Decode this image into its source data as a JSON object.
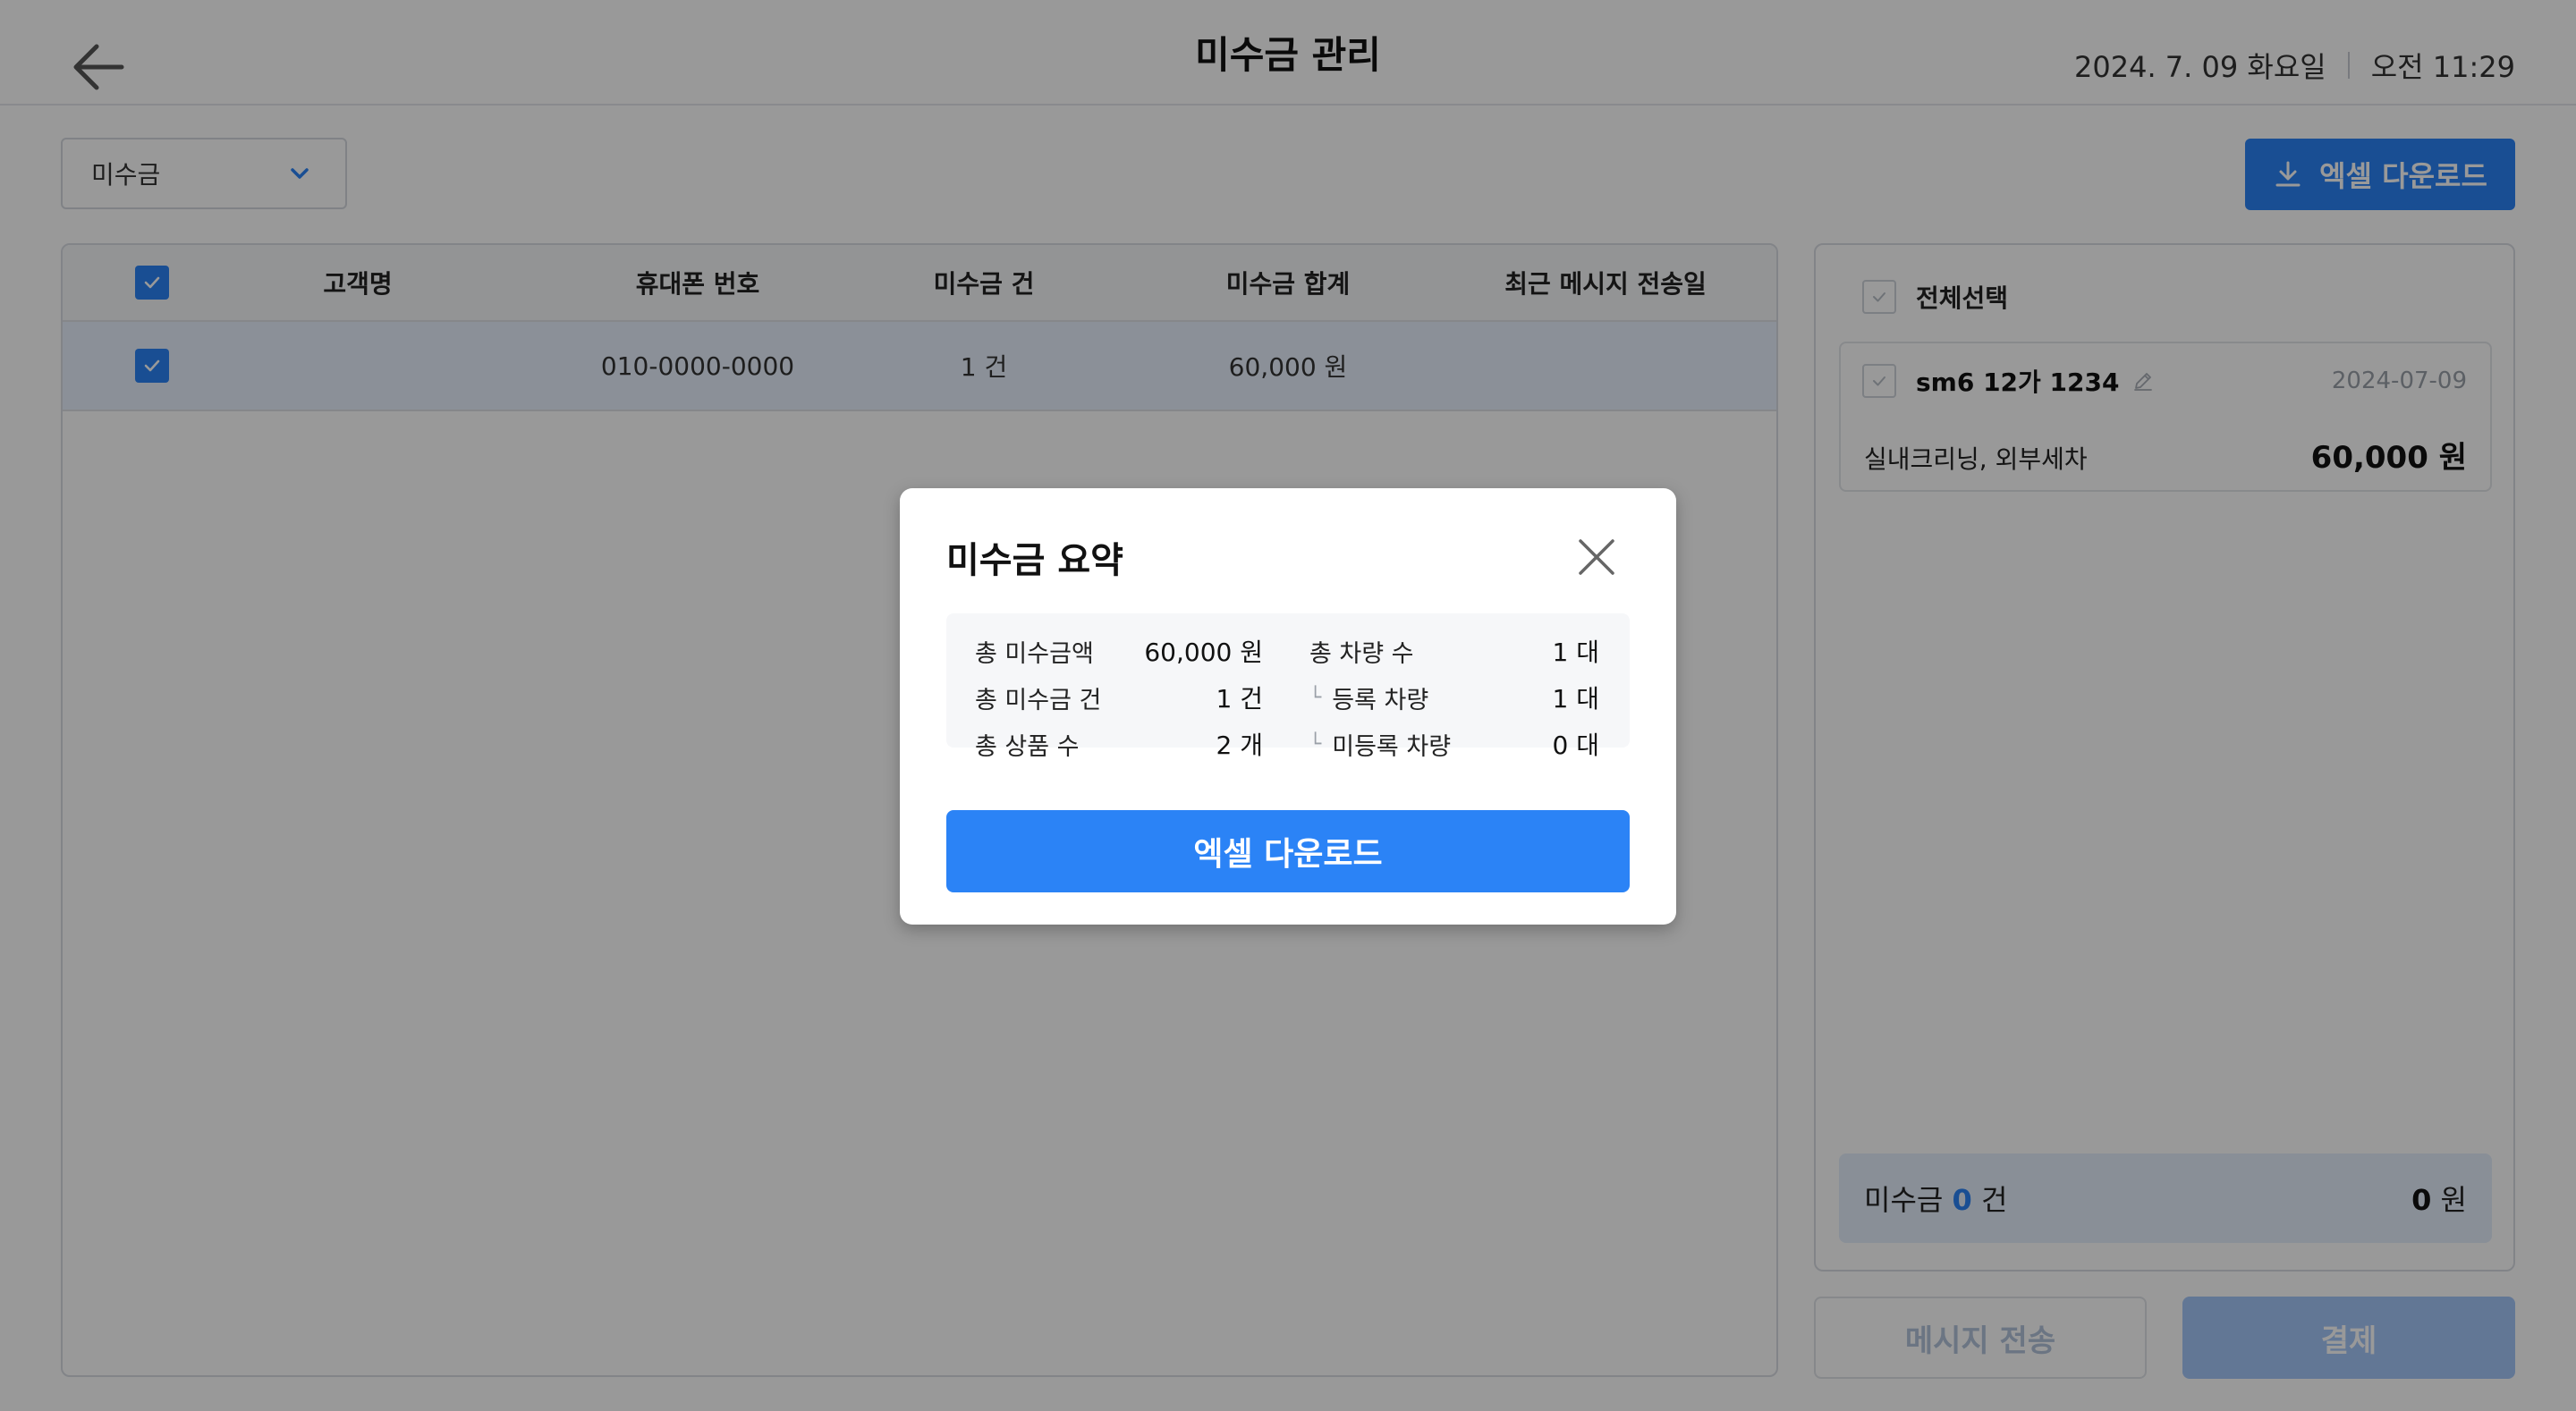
{
  "header": {
    "title": "미수금 관리",
    "date": "2024. 7. 09 화요일",
    "time": "오전 11:29"
  },
  "filter": {
    "selected": "미수금"
  },
  "toolbar": {
    "excel_label": "엑셀 다운로드"
  },
  "table": {
    "columns": [
      "고객명",
      "휴대폰 번호",
      "미수금 건",
      "미수금 합계",
      "최근 메시지 전송일"
    ],
    "rows": [
      {
        "name": "",
        "phone": "010-0000-0000",
        "count": "1 건",
        "total": "60,000 원",
        "last_sent": ""
      }
    ]
  },
  "side_panel": {
    "select_all_label": "전체선택",
    "vehicles": [
      {
        "plate": "sm6 12가 1234",
        "date": "2024-07-09",
        "services": "실내크리닝, 외부세차",
        "amount": "60,000 원"
      }
    ],
    "summary": {
      "label": "미수금",
      "count": "0",
      "count_unit": "건",
      "total_value": "0",
      "total_unit": "원"
    }
  },
  "actions": {
    "message_label": "메시지 전송",
    "pay_label": "결제"
  },
  "modal": {
    "title": "미수금 요약",
    "stats": {
      "total_amount_label": "총 미수금액",
      "total_amount": "60,000 원",
      "total_count_label": "총 미수금 건",
      "total_count": "1 건",
      "total_products_label": "총 상품 수",
      "total_products": "2 개",
      "total_vehicles_label": "총 차량 수",
      "total_vehicles": "1 대",
      "registered_label": "등록 차량",
      "registered": "1 대",
      "unregistered_label": "미등록 차량",
      "unregistered": "0 대",
      "sub_marker": "└"
    },
    "button_label": "엑셀 다운로드"
  },
  "colors": {
    "primary": "#2b83f6",
    "selected_row": "#e8f1fd",
    "disabled_button": "#a4c6f8"
  }
}
